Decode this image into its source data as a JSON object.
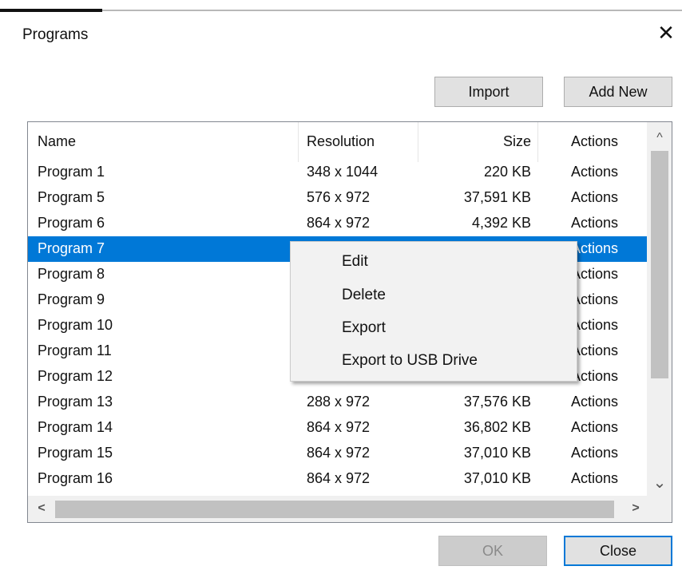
{
  "dialog": {
    "title": "Programs",
    "close_glyph": "✕"
  },
  "toolbar": {
    "import_label": "Import",
    "add_new_label": "Add New"
  },
  "table": {
    "columns": {
      "name": "Name",
      "resolution": "Resolution",
      "size": "Size",
      "actions": "Actions"
    },
    "rows": [
      {
        "name": "Program 1",
        "resolution": "348 x 1044",
        "size": "220 KB",
        "actions": "Actions"
      },
      {
        "name": "Program 5",
        "resolution": "576 x 972",
        "size": "37,591 KB",
        "actions": "Actions"
      },
      {
        "name": "Program 6",
        "resolution": "864 x 972",
        "size": "4,392 KB",
        "actions": "Actions"
      },
      {
        "name": "Program 7",
        "resolution": "",
        "size": "",
        "actions": "Actions",
        "selected": true
      },
      {
        "name": "Program 8",
        "resolution": "",
        "size": "",
        "actions": "Actions"
      },
      {
        "name": "Program 9",
        "resolution": "",
        "size": "",
        "actions": "Actions"
      },
      {
        "name": "Program 10",
        "resolution": "",
        "size": "",
        "actions": "Actions"
      },
      {
        "name": "Program 11",
        "resolution": "",
        "size": "",
        "actions": "Actions"
      },
      {
        "name": "Program 12",
        "resolution": "",
        "size": "",
        "actions": "Actions"
      },
      {
        "name": "Program 13",
        "resolution": "288 x 972",
        "size": "37,576 KB",
        "actions": "Actions"
      },
      {
        "name": "Program 14",
        "resolution": "864 x 972",
        "size": "36,802 KB",
        "actions": "Actions"
      },
      {
        "name": "Program 15",
        "resolution": "864 x 972",
        "size": "37,010 KB",
        "actions": "Actions"
      },
      {
        "name": "Program 16",
        "resolution": "864 x 972",
        "size": "37,010 KB",
        "actions": "Actions"
      }
    ]
  },
  "scrollbars": {
    "up_glyph": "^",
    "down_glyph": "⌄",
    "left_glyph": "<",
    "right_glyph": ">"
  },
  "context_menu": {
    "items": [
      "Edit",
      "Delete",
      "Export",
      "Export to USB Drive"
    ]
  },
  "footer": {
    "ok_label": "OK",
    "close_label": "Close"
  },
  "colors": {
    "selection": "#0078d7",
    "button_face": "#e1e1e1",
    "menu_bg": "#f2f2f2"
  }
}
